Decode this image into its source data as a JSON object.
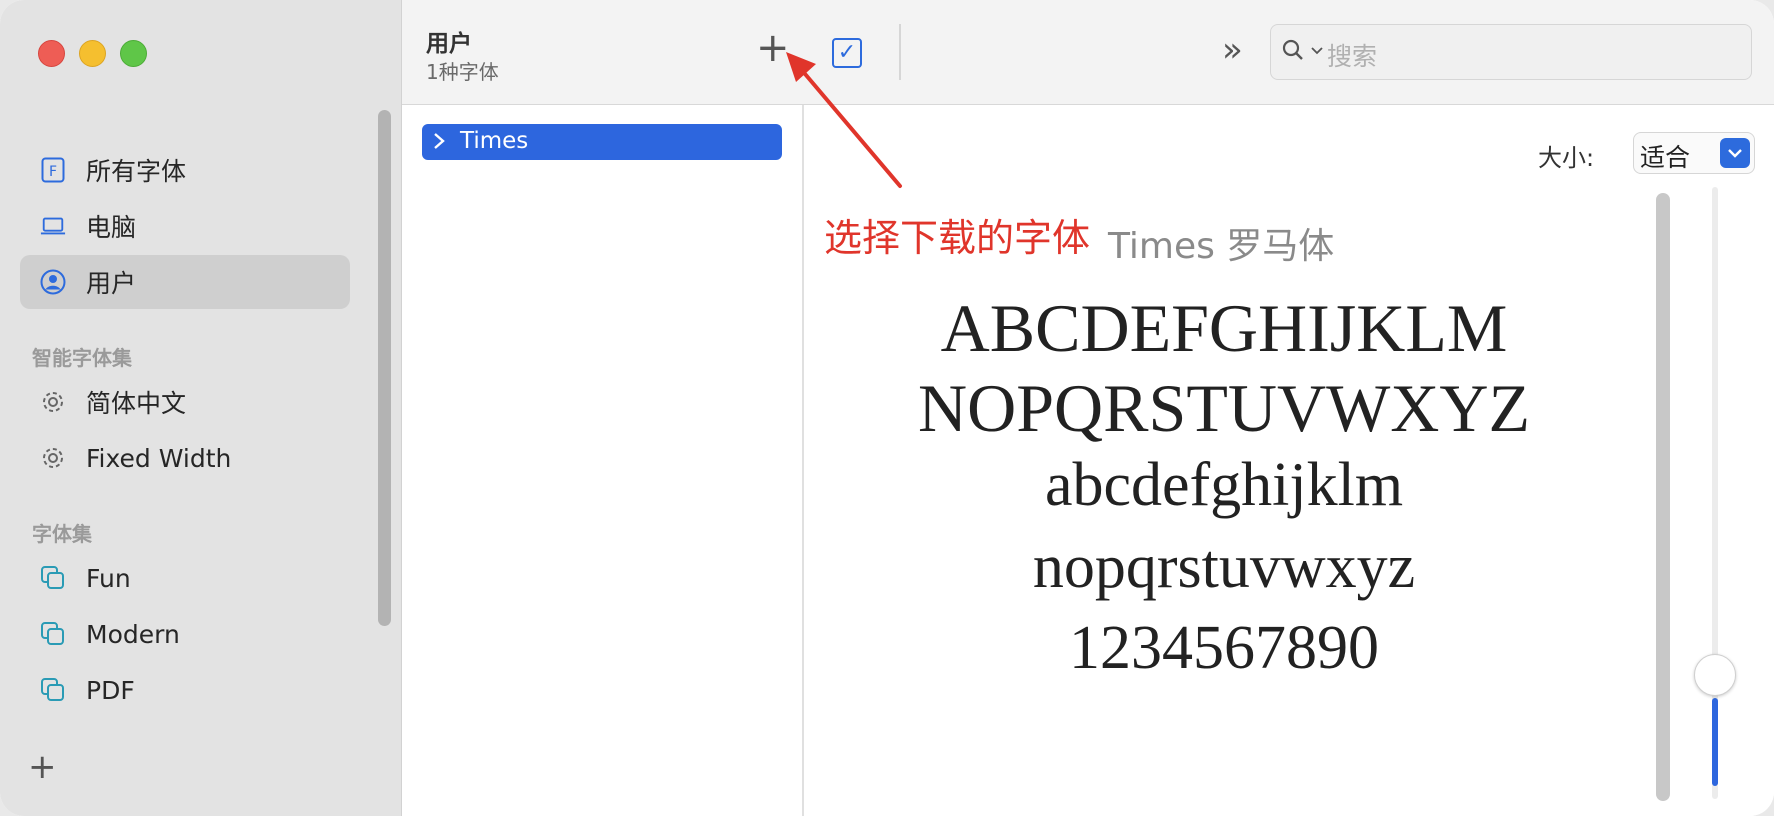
{
  "sidebar": {
    "items": [
      {
        "label": "所有字体",
        "icon": "font-book-icon"
      },
      {
        "label": "电脑",
        "icon": "laptop-icon"
      },
      {
        "label": "用户",
        "icon": "user-icon"
      }
    ],
    "smart_section": "智能字体集",
    "smart_items": [
      {
        "label": "简体中文",
        "icon": "gear-icon"
      },
      {
        "label": "Fixed Width",
        "icon": "gear-icon"
      }
    ],
    "collections_section": "字体集",
    "collections": [
      {
        "label": "Fun",
        "icon": "collection-icon"
      },
      {
        "label": "Modern",
        "icon": "collection-icon"
      },
      {
        "label": "PDF",
        "icon": "collection-icon"
      }
    ],
    "add_glyph": "+"
  },
  "toolbar": {
    "title": "用户",
    "subtitle": "1种字体",
    "add_glyph": "+",
    "more_glyph": "»",
    "search_placeholder": "搜索"
  },
  "font_list": {
    "items": [
      {
        "label": "Times"
      }
    ]
  },
  "preview": {
    "size_label": "大小:",
    "size_value": "适合",
    "font_name": "Times 罗马体",
    "lines": [
      "ABCDEFGHIJKLM",
      "NOPQRSTUVWXYZ",
      "abcdefghijklm",
      "nopqrstuvwxyz",
      "1234567890"
    ]
  },
  "annotation": {
    "text": "选择下载的字体",
    "color": "#e0352b"
  },
  "colors": {
    "accent": "#2d66de",
    "close": "#ee5d55",
    "minimize": "#f5bf2f",
    "maximize": "#5fc648"
  }
}
